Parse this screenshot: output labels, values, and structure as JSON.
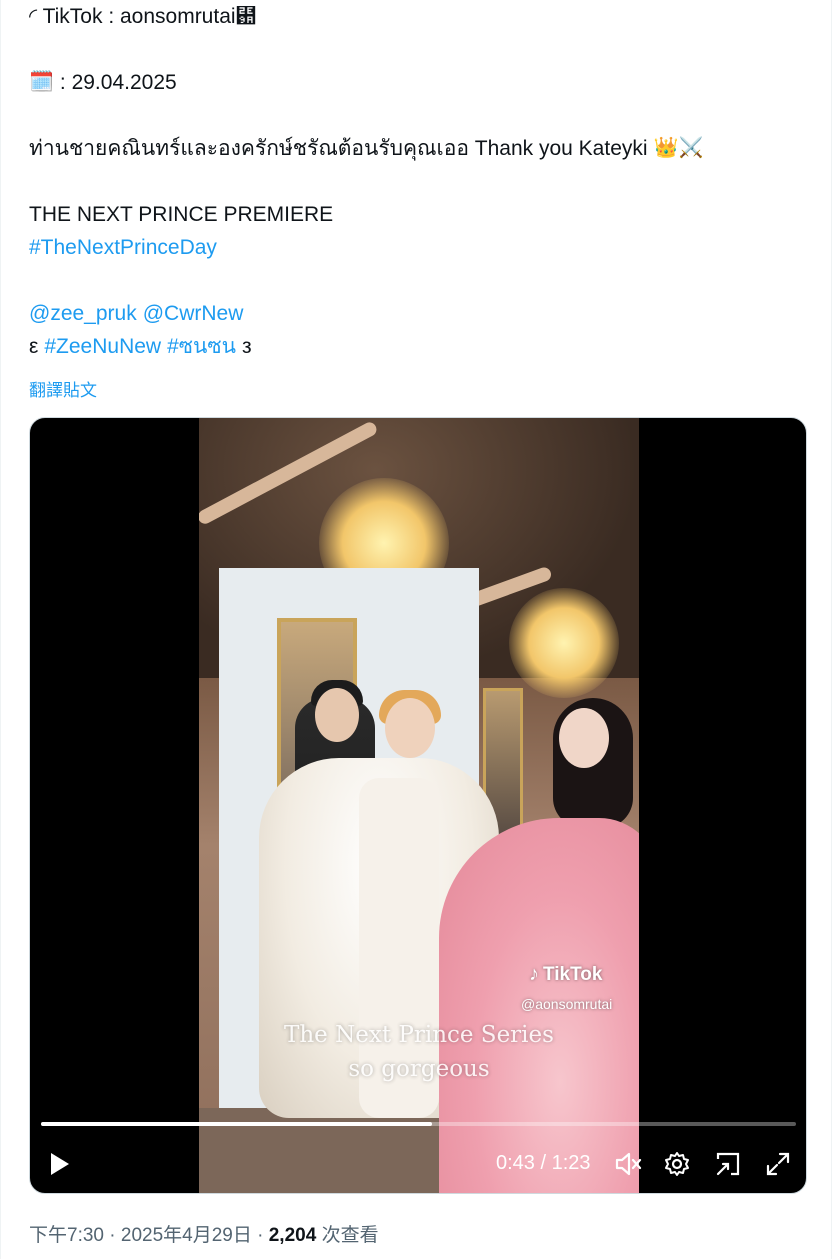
{
  "tweet": {
    "line1": "◜ TikTok : aonsomrutai⺚",
    "date_emoji": "🗓️",
    "date_text": ": 29.04.2025",
    "thai_text": "ท่านชายคณินทร์และองครักษ์ชรัณต้อนรับคุณเออ Thank you Kateyki",
    "thai_emoji": "👑⚔️",
    "premiere": "THE NEXT PRINCE PREMIERE",
    "hashtag_day": "#TheNextPrinceDay",
    "mention1": "@zee_pruk",
    "mention2": "@CwrNew",
    "bracket_left": "ε",
    "hashtag_zeenunew": "#ZeeNuNew",
    "hashtag_thai": "#ซนซน",
    "bracket_right": "з",
    "translate_label": "翻譯貼文"
  },
  "video": {
    "tiktok_logo": "TikTok",
    "tiktok_handle": "@aonsomrutai",
    "caption_line1": "The Next Prince Series",
    "caption_line2": "so gorgeous",
    "time_display": "0:43 / 1:23",
    "progress_fraction": 0.5181,
    "play_icon": "play-icon",
    "volume_icon": "volume-icon",
    "settings_icon": "gear-icon",
    "pip_icon": "picture-in-picture-icon",
    "fullscreen_icon": "fullscreen-icon"
  },
  "meta": {
    "time": "下午7:30",
    "sep1": "·",
    "date": "2025年4月29日",
    "sep2": "·",
    "views_count": "2,204",
    "views_label": "次查看"
  },
  "colors": {
    "link": "#1d9bf0",
    "text": "#0f1419",
    "secondary": "#536471"
  }
}
